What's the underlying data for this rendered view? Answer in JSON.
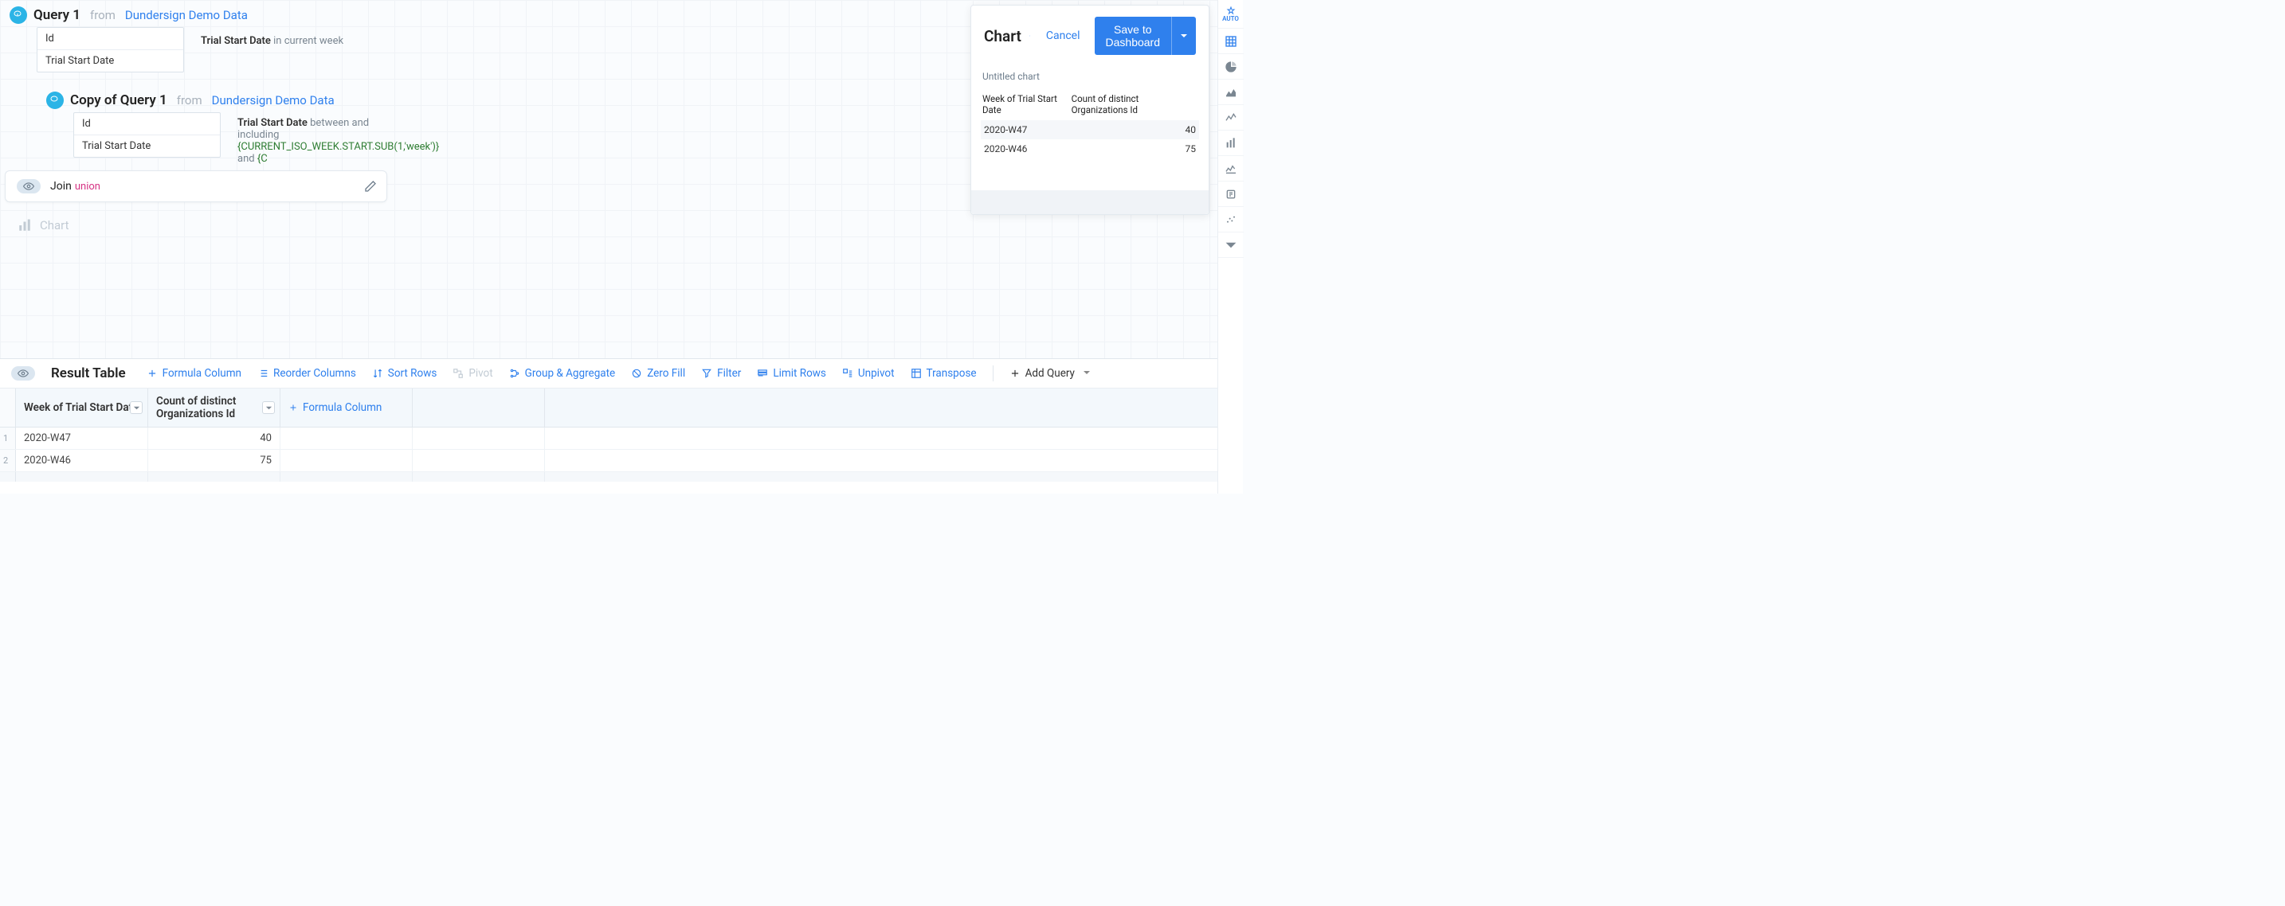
{
  "queries": [
    {
      "title": "Query 1",
      "from_word": "from",
      "source": "Dundersign Demo Data",
      "fields": [
        "Id",
        "Trial Start Date"
      ],
      "condition": {
        "field": "Trial Start Date",
        "text": "in current week"
      }
    },
    {
      "title": "Copy of Query 1",
      "from_word": "from",
      "source": "Dundersign Demo Data",
      "fields": [
        "Id",
        "Trial Start Date"
      ],
      "condition": {
        "field": "Trial Start Date",
        "prefix": "between and including ",
        "code": "{CURRENT_ISO_WEEK.START.SUB(1,'week')}",
        "mid": " and ",
        "code2": "{C"
      }
    }
  ],
  "join": {
    "label": "Join",
    "type": "union"
  },
  "chart_entry": {
    "label": "Chart"
  },
  "chart_panel": {
    "title": "Chart",
    "cancel": "Cancel",
    "save": "Save to Dashboard",
    "untitled": "Untitled chart",
    "col1": "Week of Trial Start Date",
    "col2": "Count of distinct Organizations Id",
    "rows": [
      {
        "w": "2020-W47",
        "v": "40"
      },
      {
        "w": "2020-W46",
        "v": "75"
      }
    ]
  },
  "chart_data": {
    "type": "table",
    "columns": [
      "Week of Trial Start Date",
      "Count of distinct Organizations Id"
    ],
    "rows": [
      [
        "2020-W47",
        40
      ],
      [
        "2020-W46",
        75
      ]
    ],
    "title": "Untitled chart"
  },
  "rail": {
    "auto": "AUTO"
  },
  "results": {
    "title": "Result Table",
    "toolbar": {
      "formula": "Formula Column",
      "reorder": "Reorder Columns",
      "sort": "Sort Rows",
      "pivot": "Pivot",
      "group": "Group & Aggregate",
      "zero": "Zero Fill",
      "filter": "Filter",
      "limit": "Limit Rows",
      "unpivot": "Unpivot",
      "transpose": "Transpose",
      "add": "Add Query"
    },
    "headers": {
      "c1": "Week of Trial Start Date",
      "c2": "Count of distinct Organizations Id",
      "c3_formula": "Formula Column"
    },
    "rows": [
      {
        "n": "1",
        "w": "2020-W47",
        "v": "40"
      },
      {
        "n": "2",
        "w": "2020-W46",
        "v": "75"
      }
    ]
  }
}
